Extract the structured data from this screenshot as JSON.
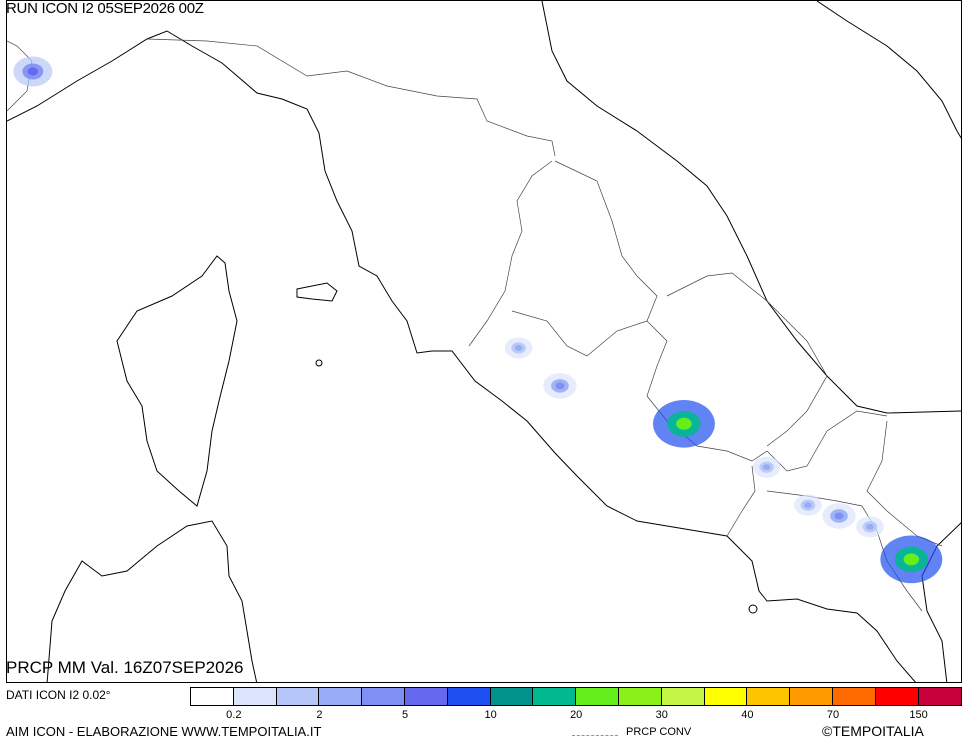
{
  "header": {
    "run_label": "RUN ICON I2 05SEP2026 00Z"
  },
  "footer": {
    "valid_label": "PRCP MM Val. 16Z07SEP2026",
    "dati_label": "DATI ICON I2 0.02°",
    "credit_label": "AIM ICON - ELABORAZIONE WWW.TEMPOITALIA.IT",
    "conv_label": "PRCP CONV",
    "brand_label": "©TEMPOITALIA"
  },
  "legend": {
    "colors": [
      "#ffffff",
      "#dce4fb",
      "#b7c6f8",
      "#97aef6",
      "#7f8ff2",
      "#6668ee",
      "#1e4ff0",
      "#00928b",
      "#00b98f",
      "#66ee1c",
      "#8bf01a",
      "#c3f545",
      "#ffff00",
      "#ffc400",
      "#ff9a00",
      "#ff6a00",
      "#ff0000",
      "#c8003c"
    ],
    "ticks": [
      "0.2",
      "2",
      "5",
      "10",
      "20",
      "30",
      "40",
      "70",
      "150"
    ]
  },
  "colors": {
    "coast": "#000000",
    "border": "#333333",
    "water": "#ffffff"
  },
  "precip_cells": [
    {
      "level": 5,
      "lon": 7.3,
      "lat": 45.3,
      "mm": 10
    },
    {
      "level": 3,
      "lon": 12.0,
      "lat": 42.75,
      "mm": 3
    },
    {
      "level": 4,
      "lon": 12.4,
      "lat": 42.4,
      "mm": 5
    },
    {
      "level": 9,
      "lon": 13.6,
      "lat": 42.05,
      "mm": 20
    },
    {
      "level": 3,
      "lon": 14.4,
      "lat": 41.65,
      "mm": 2
    },
    {
      "level": 3,
      "lon": 14.8,
      "lat": 41.3,
      "mm": 2
    },
    {
      "level": 4,
      "lon": 15.1,
      "lat": 41.2,
      "mm": 4
    },
    {
      "level": 3,
      "lon": 15.4,
      "lat": 41.1,
      "mm": 3
    },
    {
      "level": 9,
      "lon": 15.8,
      "lat": 40.8,
      "mm": 20
    }
  ]
}
